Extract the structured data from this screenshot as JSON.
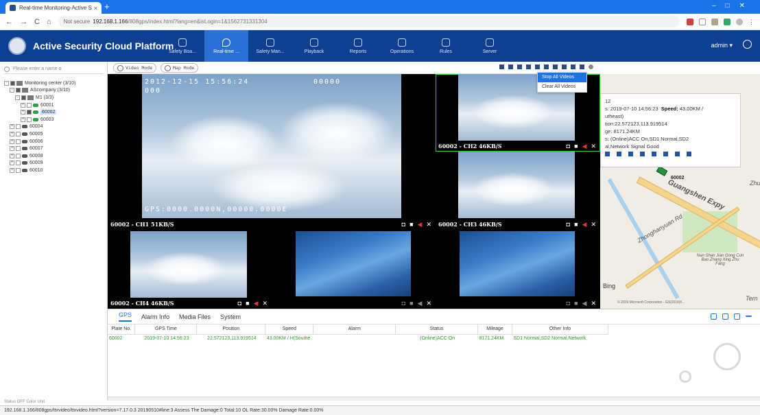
{
  "browser": {
    "tab_title": "Real-time Monitoring-Active S",
    "url_prefix": "Not secure",
    "url_host": "192.168.1.166",
    "url_path": "/808gps/index.html?lang=en&isLogin=1&1562731331304"
  },
  "app": {
    "title": "Active Security Cloud Platform",
    "user": "admin",
    "menu": [
      {
        "label": "Safety Boa..."
      },
      {
        "label": "Real-time ..."
      },
      {
        "label": "Safety Man..."
      },
      {
        "label": "Playback"
      },
      {
        "label": "Reports"
      },
      {
        "label": "Operations"
      },
      {
        "label": "Rules"
      },
      {
        "label": "Server"
      }
    ]
  },
  "sidebar": {
    "search_placeholder": "Please enter a name o",
    "tree": [
      {
        "label": "Monitoring center (3/10)"
      },
      {
        "label": "AScompany (3/10)"
      },
      {
        "label": "M1 (3/3)"
      },
      {
        "label": "60001"
      },
      {
        "label": "60002"
      },
      {
        "label": "60003"
      },
      {
        "label": "60004"
      },
      {
        "label": "60005"
      },
      {
        "label": "60006"
      },
      {
        "label": "60007"
      },
      {
        "label": "60008"
      },
      {
        "label": "60009"
      },
      {
        "label": "60010"
      }
    ],
    "bottom_status": "Status  OFF   Color   Unit"
  },
  "video": {
    "video_mode": "Video Mode",
    "map_mode": "Map Mode",
    "dropdown": [
      "Stop All Videos",
      "Clear All Videos"
    ],
    "osd_date": "2012-12-15 15:56:24",
    "osd_code": "00000",
    "osd_sub": "000",
    "osd_gps": "GPS:0000.0000N,00000.0000E",
    "cells": [
      {
        "caption": "60002 - CH1 51KB/S"
      },
      {
        "caption": "60002 - CH2 46KB/S"
      },
      {
        "caption": "60002 - CH3 46KB/S"
      },
      {
        "caption": "60002 - CH4 46KB/S"
      }
    ]
  },
  "map": {
    "popup": {
      "l1": "12",
      "l2": "s: 2019-07-10 14:56:23",
      "speed_label": "Speed:",
      "speed": "43.00KM /",
      "l3": "utheast)",
      "l4": "tion:22.572123,113.919514",
      "l5": "ge: 8171.24KM",
      "l6": "s: (Online)ACC On,SD1 Normal,SD2",
      "l7": "al,Network Signal Good"
    },
    "car_label": "60002",
    "labels": [
      "Guangshen Expy",
      "Zhonghanyuan Rd",
      "Nan Shan Jian Gong Cun Bao Zhang Xing Zhu Fang",
      "Zhu",
      "Tern"
    ],
    "bing": "Bing",
    "copyright": "© 2019 Microsoft Corporation - GS(2018)5..."
  },
  "bottom": {
    "tabs": [
      "GPS",
      "Alarm Info",
      "Media Files",
      "System"
    ],
    "columns": [
      "Plate No.",
      "GPS Time",
      "Position",
      "Speed",
      "Alarm",
      "Status",
      "Mileage",
      "Other Info"
    ],
    "rows": [
      [
        "60002",
        "2019-07-10 14:56:23",
        "22.572123,113.919514",
        "43.00KM / H(Southe",
        "",
        "(Online)ACC On",
        "8171.24KM",
        "SD1 Normal,SD2 Normal,Network"
      ]
    ]
  },
  "statusbar": {
    "text": "192.168.1.166/808gps/ttxvideo/ttxvideo.html?version=7.17.0.3 20190510#line:3   Assess The Damage:0   Total:10   OL Rate:30.00%   Damage Rate:0.00%"
  }
}
